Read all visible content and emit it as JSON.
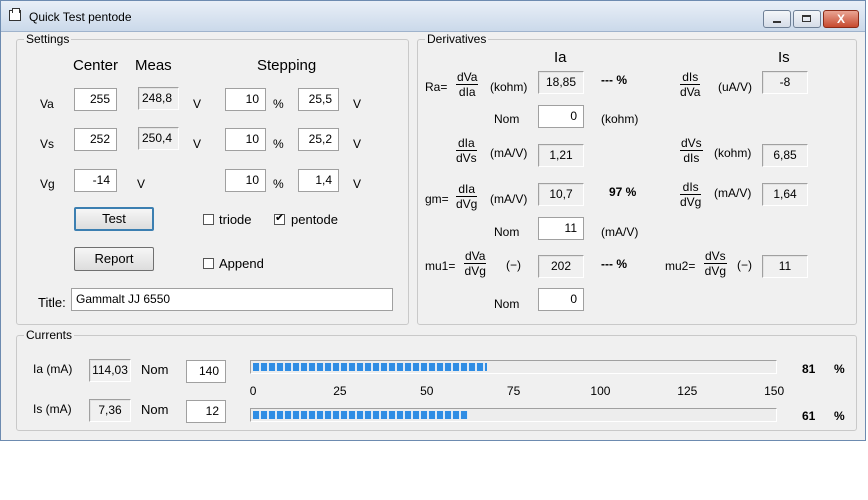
{
  "window": {
    "title": "Quick Test pentode",
    "close_label": "X"
  },
  "settings": {
    "group_label": "Settings",
    "headers": {
      "center": "Center",
      "meas": "Meas",
      "stepping": "Stepping"
    },
    "rows": [
      {
        "label": "Va",
        "center": "255",
        "meas": "248,8",
        "meas_unit": "V",
        "step": "10",
        "step_unit": "%",
        "step_value": "25,5",
        "step_value_unit": "V"
      },
      {
        "label": "Vs",
        "center": "252",
        "meas": "250,4",
        "meas_unit": "V",
        "step": "10",
        "step_unit": "%",
        "step_value": "25,2",
        "step_value_unit": "V"
      },
      {
        "label": "Vg",
        "center": "-14",
        "meas": "",
        "meas_unit": "V",
        "step": "10",
        "step_unit": "%",
        "step_value": "1,4",
        "step_value_unit": "V"
      }
    ],
    "test_button": "Test",
    "report_button": "Report",
    "triode_label": "triode",
    "pentode_label": "pentode",
    "append_label": "Append",
    "triode_checked": false,
    "pentode_checked": true,
    "append_checked": false,
    "title_label": "Title:",
    "title_value": "Gammalt JJ 6550"
  },
  "derivatives": {
    "group_label": "Derivatives",
    "col_ia": "Ia",
    "col_is": "Is",
    "ra": {
      "prefix": "Ra=",
      "num": "dVa",
      "den": "dIa",
      "unit": "(kohm)",
      "value": "18,85",
      "pct": "--- %"
    },
    "nom_ra": {
      "label": "Nom",
      "value": "0",
      "unit": "(kohm)"
    },
    "dis_dva": {
      "num": "dIs",
      "den": "dVa",
      "unit": "(uA/V)",
      "value": "-8"
    },
    "dia_dvs": {
      "num": "dIa",
      "den": "dVs",
      "unit": "(mA/V)",
      "value": "1,21"
    },
    "dvs_dis": {
      "num": "dVs",
      "den": "dIs",
      "unit": "(kohm)",
      "value": "6,85"
    },
    "gm": {
      "prefix": "gm=",
      "num": "dIa",
      "den": "dVg",
      "unit": "(mA/V)",
      "value": "10,7",
      "pct": "97 %"
    },
    "dis_dvg": {
      "num": "dIs",
      "den": "dVg",
      "unit": "(mA/V)",
      "value": "1,64"
    },
    "nom_gm": {
      "label": "Nom",
      "value": "11",
      "unit": "(mA/V)"
    },
    "mu1": {
      "prefix": "mu1=",
      "num": "dVa",
      "den": "dVg",
      "unit": "(−)",
      "value": "202",
      "pct": "--- %"
    },
    "mu2": {
      "prefix": "mu2=",
      "num": "dVs",
      "den": "dVg",
      "unit": "(−)",
      "value": "11"
    },
    "nom_mu": {
      "label": "Nom",
      "value": "0"
    }
  },
  "currents": {
    "group_label": "Currents",
    "ia": {
      "label": "Ia (mA)",
      "value": "114,03",
      "nom_label": "Nom",
      "nom": "140",
      "percent": 81,
      "percent_text": "81",
      "pct_sign": "%"
    },
    "is": {
      "label": "Is (mA)",
      "value": "7,36",
      "nom_label": "Nom",
      "nom": "12",
      "percent": 61,
      "percent_text": "61",
      "pct_sign": "%"
    },
    "scale_ticks": [
      "0",
      "25",
      "50",
      "75",
      "100",
      "125",
      "150"
    ],
    "bar_color": "#2f8de4"
  }
}
